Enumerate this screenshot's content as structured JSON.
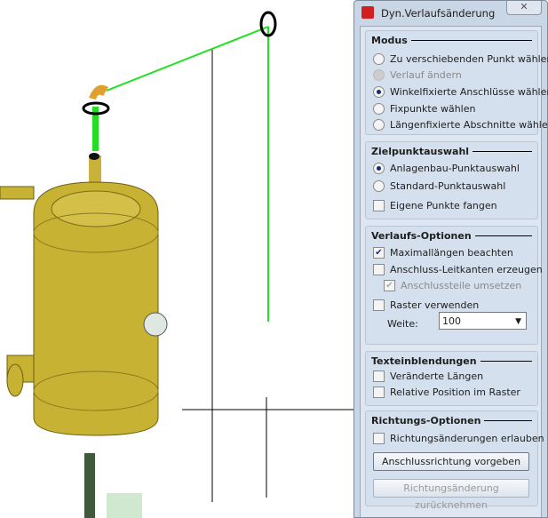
{
  "window": {
    "title": "Dyn.Verlaufsänderung",
    "close_label": "✕"
  },
  "modus": {
    "heading": "Modus",
    "options": [
      {
        "label": "Zu verschiebenden Punkt wählen",
        "selected": false,
        "enabled": true
      },
      {
        "label": "Verlauf ändern",
        "selected": false,
        "enabled": false
      },
      {
        "label": "Winkelfixierte Anschlüsse wählen",
        "selected": true,
        "enabled": true
      },
      {
        "label": "Fixpunkte wählen",
        "selected": false,
        "enabled": true
      },
      {
        "label": "Längenfixierte Abschnitte wählen",
        "selected": false,
        "enabled": true
      }
    ]
  },
  "ziel": {
    "heading": "Zielpunktauswahl",
    "options": [
      {
        "label": "Anlagenbau-Punktauswahl",
        "selected": true
      },
      {
        "label": "Standard-Punktauswahl",
        "selected": false
      }
    ],
    "fangen": {
      "label": "Eigene Punkte fangen",
      "checked": false
    }
  },
  "verlauf": {
    "heading": "Verlaufs-Optionen",
    "max": {
      "label": "Maximallängen beachten",
      "checked": true
    },
    "leit": {
      "label": "Anschluss-Leitkanten erzeugen",
      "checked": false
    },
    "umsetzen": {
      "label": "Anschlussteile umsetzen",
      "checked": true,
      "enabled": false
    },
    "raster": {
      "label": "Raster verwenden",
      "checked": false
    },
    "weite_label": "Weite:",
    "weite_value": "100"
  },
  "text": {
    "heading": "Texteinblendungen",
    "laengen": {
      "label": "Veränderte Längen",
      "checked": false
    },
    "position": {
      "label": "Relative Position im Raster",
      "checked": false
    }
  },
  "richtung": {
    "heading": "Richtungs-Optionen",
    "erlauben": {
      "label": "Richtungsänderungen erlauben",
      "checked": false
    },
    "vorgeben": "Anschlussrichtung vorgeben",
    "zuruecknehmen": "Richtungsänderung zurücknehmen"
  },
  "check_mark": "✔"
}
